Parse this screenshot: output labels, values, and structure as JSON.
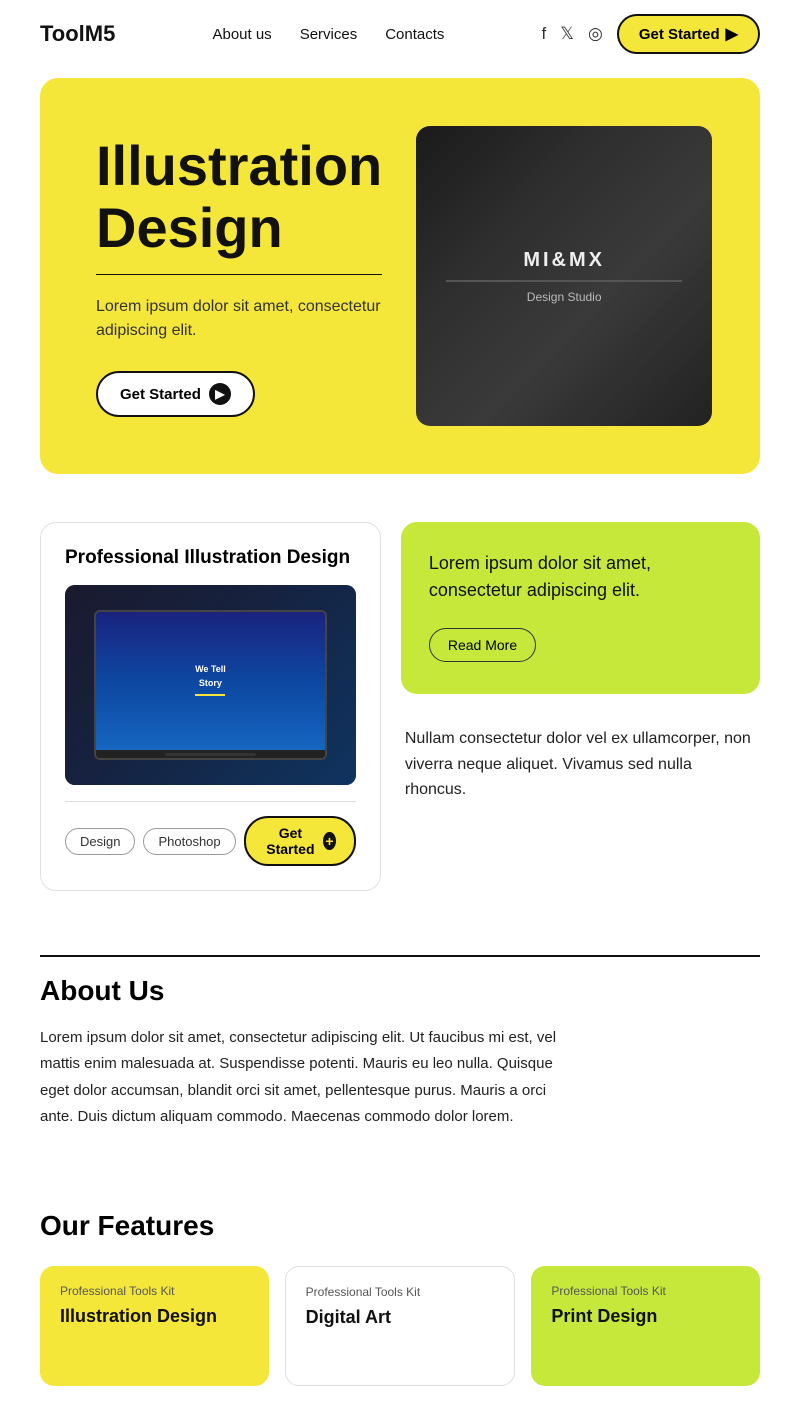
{
  "navbar": {
    "logo": "ToolM5",
    "links": [
      {
        "label": "About us",
        "id": "about-us"
      },
      {
        "label": "Services",
        "id": "services"
      },
      {
        "label": "Contacts",
        "id": "contacts"
      }
    ],
    "get_started_label": "Get Started"
  },
  "hero": {
    "title_line1": "Illustration",
    "title_line2": "Design",
    "description": "Lorem ipsum dolor sit amet, consectetur adipiscing elit.",
    "get_started_label": "Get Started",
    "image_text": "MI&MX"
  },
  "cards_section": {
    "left_card": {
      "title": "Professional Illustration Design",
      "tag1": "Design",
      "tag2": "Photoshop",
      "get_started_label": "Get Started"
    },
    "right_green_card": {
      "text": "Lorem ipsum dolor sit amet, consectetur adipiscing elit.",
      "read_more_label": "Read More"
    },
    "right_text_block": {
      "text": "Nullam consectetur dolor vel ex ullamcorper, non viverra neque aliquet. Vivamus sed nulla rhoncus."
    }
  },
  "about": {
    "title": "About Us",
    "body": "Lorem ipsum dolor sit amet, consectetur adipiscing elit. Ut faucibus mi est, vel mattis enim malesuada at. Suspendisse potenti. Mauris eu leo nulla. Quisque eget dolor accumsan, blandit orci sit amet, pellentesque purus. Mauris a orci ante. Duis dictum aliquam commodo. Maecenas commodo dolor lorem."
  },
  "features": {
    "title": "Our Features",
    "cards": [
      {
        "label": "Professional Tools Kit",
        "title": "Illustration Design",
        "style": "yellow"
      },
      {
        "label": "Professional Tools Kit",
        "title": "Digital Art",
        "style": "white"
      },
      {
        "label": "Professional Tools Kit",
        "title": "Print Design",
        "style": "green"
      }
    ]
  }
}
